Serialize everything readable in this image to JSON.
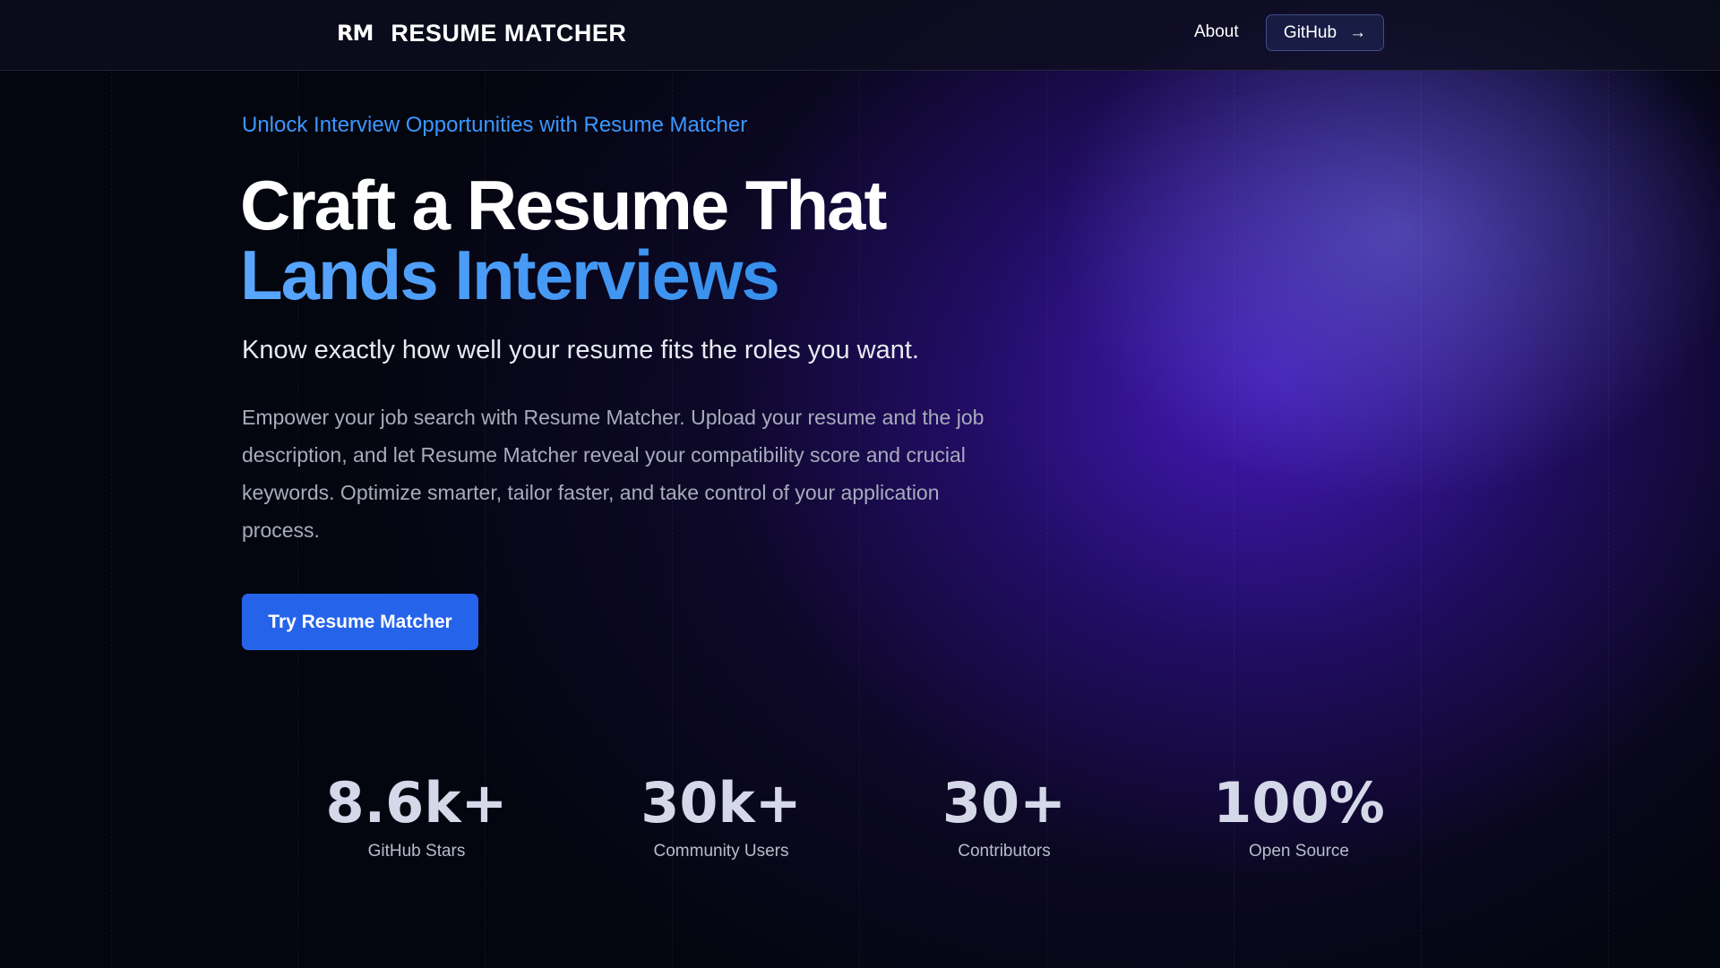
{
  "header": {
    "logo_mark": "RM",
    "logo_text": "RESUME MATCHER",
    "nav_about": "About",
    "nav_github": "GitHub",
    "github_arrow_icon": "arrow-right-icon"
  },
  "hero": {
    "eyebrow": "Unlock Interview Opportunities with Resume Matcher",
    "headline_line1": "Craft a Resume That",
    "headline_line2": "Lands Interviews",
    "subhead": "Know exactly how well your resume fits the roles you want.",
    "description": "Empower your job search with Resume Matcher. Upload your resume and the job description, and let Resume Matcher reveal your compatibility score and crucial keywords. Optimize smarter, tailor faster, and take control of your application process.",
    "cta_label": "Try Resume Matcher"
  },
  "stats": [
    {
      "value": "8.6k+",
      "label": "GitHub Stars"
    },
    {
      "value": "30k+",
      "label": "Community Users"
    },
    {
      "value": "30+",
      "label": "Contributors"
    },
    {
      "value": "100%",
      "label": "Open Source"
    }
  ],
  "colors": {
    "accent": "#3b97ff",
    "cta": "#2563eb",
    "background": "#04060f",
    "glow": "#4c1fd6"
  }
}
